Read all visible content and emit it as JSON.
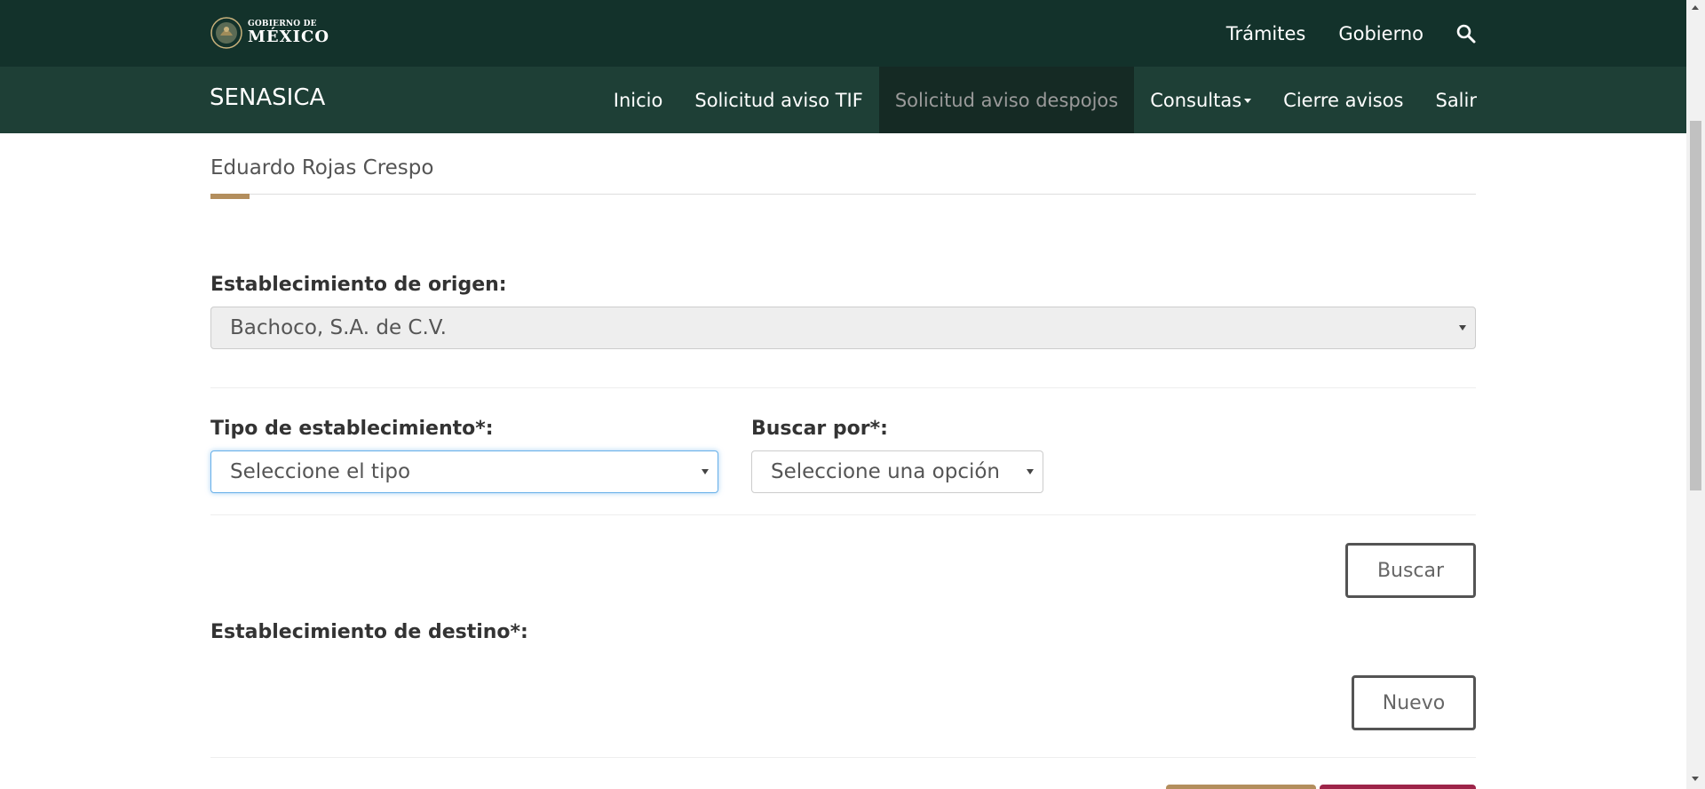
{
  "header": {
    "logo_small": "GOBIERNO DE",
    "logo_big": "MÉXICO",
    "links": [
      "Trámites",
      "Gobierno"
    ],
    "search_icon": "search-icon"
  },
  "nav": {
    "brand": "SENASICA",
    "items": [
      {
        "label": "Inicio"
      },
      {
        "label": "Solicitud aviso TIF"
      },
      {
        "label": "Solicitud aviso despojos",
        "active": true
      },
      {
        "label": "Consultas",
        "dropdown": true
      },
      {
        "label": "Cierre avisos"
      },
      {
        "label": "Salir"
      }
    ]
  },
  "user": {
    "name": "Eduardo Rojas Crespo"
  },
  "form": {
    "origen_label": "Establecimiento de origen:",
    "origen_value": "Bachoco, S.A. de C.V.",
    "tipo_label": "Tipo de establecimiento*:",
    "tipo_value": "Seleccione el tipo",
    "buscar_por_label": "Buscar por*:",
    "buscar_por_value": "Seleccione una opción",
    "buscar_button": "Buscar",
    "destino_label": "Establecimiento de destino*:",
    "nuevo_button": "Nuevo"
  },
  "colors": {
    "topbar": "#13322b",
    "navbar": "#1e3f36",
    "accent_gold": "#b38e5d",
    "accent_wine": "#9d2449"
  }
}
